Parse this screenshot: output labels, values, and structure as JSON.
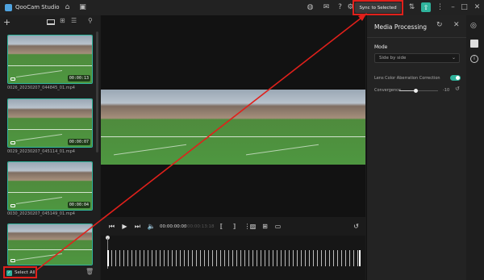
{
  "app": {
    "title": "QooCam Studio"
  },
  "toolbar": {
    "sync_label": "Sync to Selected"
  },
  "clips": [
    {
      "name": "0026_20230207_044845_01.mp4",
      "duration": "00:00:13"
    },
    {
      "name": "0029_20230207_045114_01.mp4",
      "duration": "00:00:07"
    },
    {
      "name": "0030_20230207_045149_01.mp4",
      "duration": "00:00:04"
    },
    {
      "name": "",
      "duration": ""
    }
  ],
  "left": {
    "select_all": "Select All"
  },
  "player": {
    "current_time": "00:00:00:00",
    "total_time": "00:00:13:18"
  },
  "panel": {
    "title": "Media Processing",
    "mode_label": "Mode",
    "mode_value": "Side by side",
    "lens_label": "Lens Color Aberration Correction",
    "lens_on": true,
    "convergence_label": "Convergence",
    "convergence_value": "-10"
  },
  "colors": {
    "accent": "#2fb39c",
    "highlight": "#e0201b",
    "bg": "#1c1c1c"
  },
  "icons": [
    "home-icon",
    "gallery-icon",
    "globe-icon",
    "mail-icon",
    "help-icon",
    "settings-icon",
    "sync-icon",
    "export-icon",
    "menu-icon",
    "minimize-icon",
    "maximize-icon",
    "close-icon"
  ]
}
